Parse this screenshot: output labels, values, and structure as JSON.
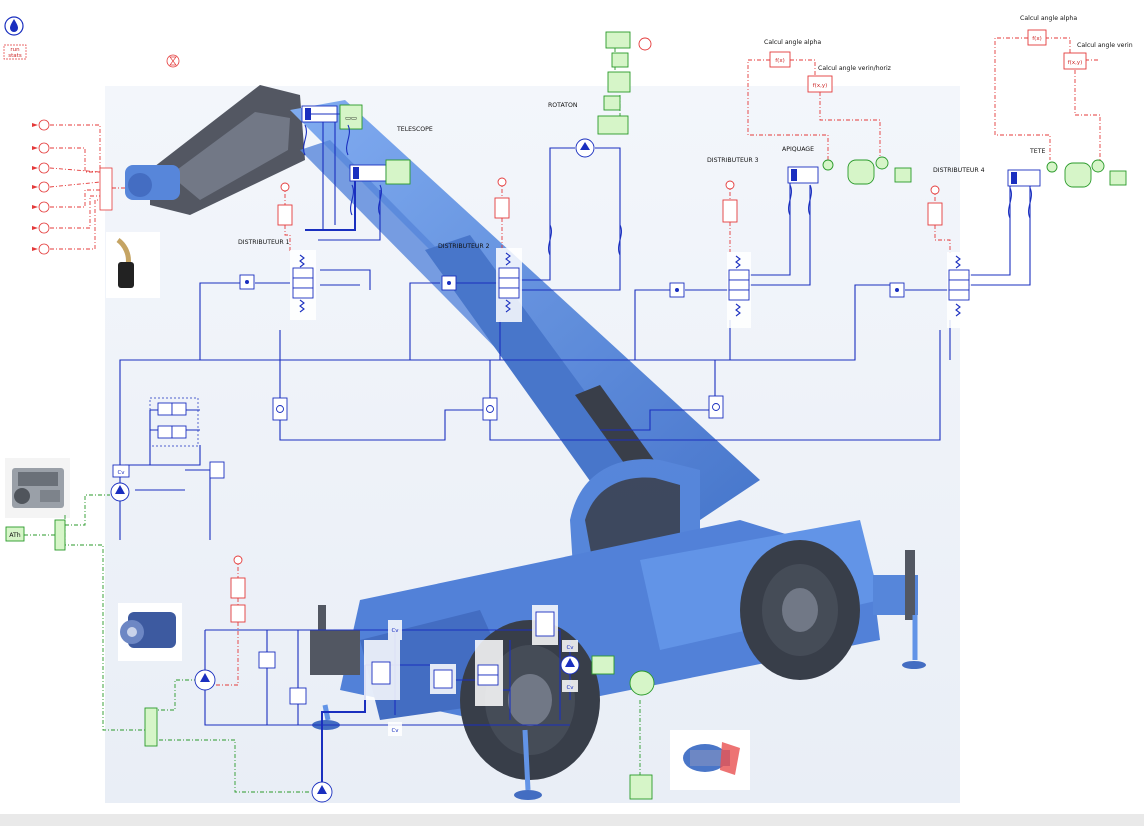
{
  "toolbar": {
    "run_stats": "run\nstats"
  },
  "labels": {
    "telescope": "TELESCOPE",
    "rotation": "ROTATON",
    "distributeur1": "DISTRIBUTEUR 1",
    "distributeur2": "DISTRIBUTEUR 2",
    "distributeur3": "DISTRIBUTEUR 3",
    "distributeur4": "DISTRIBUTEUR 4",
    "apiquage": "APIQUAGE",
    "tete": "TETE",
    "calcul_alpha_1": "Calcul angle alpha",
    "calcul_verin_horiz": "Calcul angle verin/horiz",
    "calcul_alpha_2": "Calcul angle alpha",
    "calcul_verin": "Calcul angle verin"
  },
  "blocks": {
    "fx": "f(x)",
    "fxy": "f(x,y)",
    "atm": "ATh",
    "cv": "Cv"
  },
  "colors": {
    "hydraulic": "#1a2fbf",
    "signal": "#e43a3a",
    "mechanical": "#2a9a2a",
    "machine_body": "#5b8fe6"
  },
  "icons": [
    "water-drop-icon",
    "hourglass-icon",
    "engine-photo",
    "pump-photo",
    "joystick-photo",
    "rotary-actuator-photo"
  ]
}
